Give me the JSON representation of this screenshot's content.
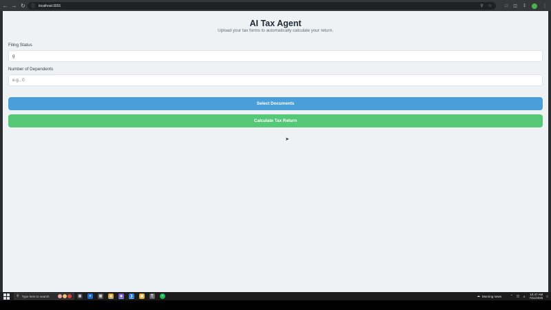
{
  "browser": {
    "url": "localhost:3001"
  },
  "app": {
    "title": "AI Tax Agent",
    "subtitle": "Upload your tax forms to automatically calculate your return."
  },
  "form": {
    "filing_status": {
      "label": "Filing Status",
      "value": "g"
    },
    "dependents": {
      "label": "Number of Dependents",
      "placeholder": "e.g., 0"
    },
    "select_documents_label": "Select Documents",
    "calculate_label": "Calculate Tax Return"
  },
  "taskbar": {
    "search_placeholder": "Type here to search",
    "weather": "Morning news",
    "time": "10:47 AM",
    "date": "7/11/2025"
  },
  "colors": {
    "page_bg": "#eef2f5",
    "select_button": "#4a9fd8",
    "calculate_button": "#55c878"
  }
}
